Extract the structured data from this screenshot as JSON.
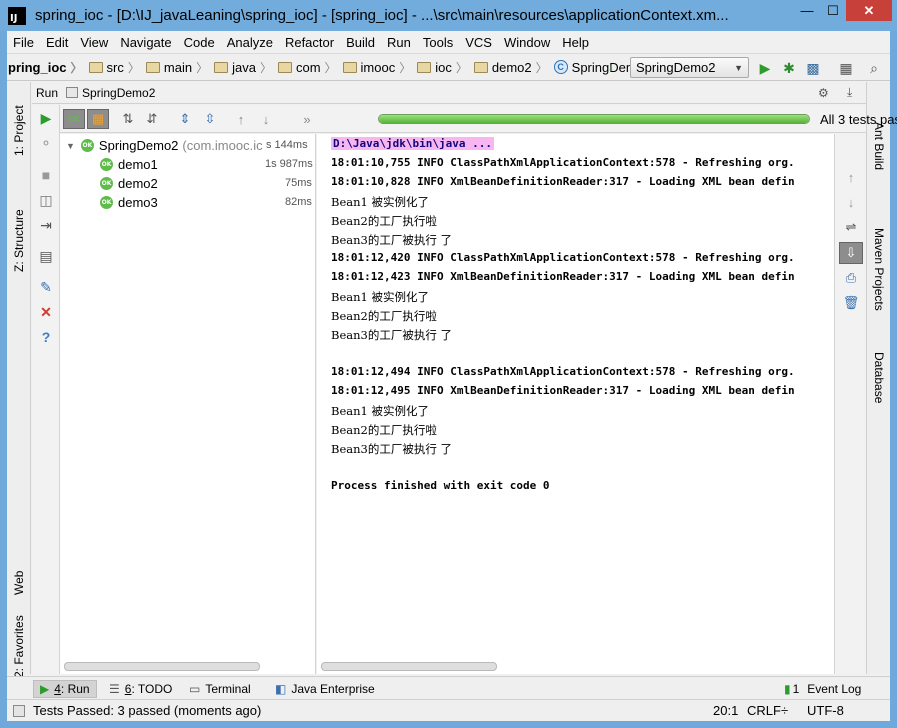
{
  "window": {
    "app_icon": "IJ",
    "title": "spring_ioc - [D:\\IJ_javaLeaning\\spring_ioc] - [spring_ioc] - ...\\src\\main\\resources\\applicationContext.xm...",
    "minimize": "—",
    "maximize": "☐",
    "close": "✕"
  },
  "menu": [
    "File",
    "Edit",
    "View",
    "Navigate",
    "Code",
    "Analyze",
    "Refactor",
    "Build",
    "Run",
    "Tools",
    "VCS",
    "Window",
    "Help"
  ],
  "breadcrumbs": [
    "pring_ioc",
    "src",
    "main",
    "java",
    "com",
    "imooc",
    "ioc",
    "demo2",
    "SpringDemo2"
  ],
  "run_config": "SpringDemo2",
  "left_tabs": {
    "project": "1: Project",
    "structure": "Z: Structure",
    "web": "Web",
    "favorites": "2: Favorites"
  },
  "right_tabs": {
    "ant": "Ant Build",
    "maven": "Maven Projects",
    "database": "Database"
  },
  "run_panel": {
    "label": "Run",
    "config_tab": "SpringDemo2",
    "tests_status": "All 3 tests passe",
    "progress": 1.0,
    "tree": {
      "root": {
        "name": "SpringDemo2",
        "detail": "(com.imooc.ic",
        "duration": "s 144ms"
      },
      "children": [
        {
          "name": "demo1",
          "duration": "1s 987ms"
        },
        {
          "name": "demo2",
          "duration": "75ms"
        },
        {
          "name": "demo3",
          "duration": "82ms"
        }
      ]
    },
    "console": [
      {
        "text": "D:\\Java\\jdk\\bin\\java ...",
        "style": "cmd"
      },
      {
        "text": "18:01:10,755  INFO ClassPathXmlApplicationContext:578 - Refreshing org.",
        "style": "bold"
      },
      {
        "text": "18:01:10,828  INFO XmlBeanDefinitionReader:317 - Loading XML bean defin",
        "style": "bold"
      },
      {
        "text": "Bean1 被实例化了",
        "style": "normal"
      },
      {
        "text": "Bean2的工厂执行啦",
        "style": "normal"
      },
      {
        "text": "Bean3的工厂被执行 了",
        "style": "normal"
      },
      {
        "text": "18:01:12,420  INFO ClassPathXmlApplicationContext:578 - Refreshing org.",
        "style": "bold"
      },
      {
        "text": "18:01:12,423  INFO XmlBeanDefinitionReader:317 - Loading XML bean defin",
        "style": "bold"
      },
      {
        "text": "Bean1 被实例化了",
        "style": "normal"
      },
      {
        "text": "Bean2的工厂执行啦",
        "style": "normal"
      },
      {
        "text": "Bean3的工厂被执行 了",
        "style": "normal"
      },
      {
        "text": "",
        "style": "normal"
      },
      {
        "text": "18:01:12,494  INFO ClassPathXmlApplicationContext:578 - Refreshing org.",
        "style": "bold"
      },
      {
        "text": "18:01:12,495  INFO XmlBeanDefinitionReader:317 - Loading XML bean defin",
        "style": "bold"
      },
      {
        "text": "Bean1 被实例化了",
        "style": "normal"
      },
      {
        "text": "Bean2的工厂执行啦",
        "style": "normal"
      },
      {
        "text": "Bean3的工厂被执行 了",
        "style": "normal"
      },
      {
        "text": "",
        "style": "normal"
      },
      {
        "text": "Process finished with exit code 0",
        "style": "bold"
      }
    ]
  },
  "bottom_tabs": [
    {
      "key": "4",
      "label": ": Run",
      "icon": "run-icon"
    },
    {
      "key": "6",
      "label": ": TODO",
      "icon": "todo-icon"
    },
    {
      "key": "",
      "label": "Terminal",
      "icon": "terminal-icon"
    },
    {
      "key": "",
      "label": "Java Enterprise",
      "icon": "java-enterprise-icon"
    }
  ],
  "event_log": {
    "badge": "1",
    "label": "Event Log"
  },
  "status": {
    "message": "Tests Passed: 3 passed (moments ago)",
    "position": "20:1",
    "line_sep": "CRLF÷",
    "encoding": "UTF-8"
  },
  "colors": {
    "pass_green": "#5fbb4a",
    "cmd_highlight": "#f7b6ef",
    "title_bar": "#72acdc"
  }
}
